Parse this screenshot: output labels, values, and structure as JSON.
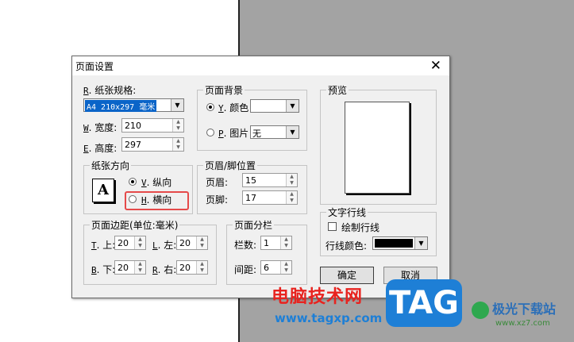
{
  "dialog": {
    "title": "页面设置",
    "close_glyph": "✕",
    "paper_size": {
      "label": "纸张规格",
      "hotkey": "R",
      "value": "A4 210x297 毫米"
    },
    "width": {
      "label": "宽度",
      "hotkey": "W",
      "value": "210"
    },
    "height": {
      "label": "高度",
      "hotkey": "E",
      "value": "297"
    },
    "orientation": {
      "title": "纸张方向",
      "icon_letter": "A",
      "portrait": {
        "hotkey": "V",
        "label": "纵向",
        "checked": true
      },
      "landscape": {
        "hotkey": "H",
        "label": "横向",
        "checked": false
      }
    },
    "background": {
      "title": "页面背景",
      "color": {
        "hotkey": "Y",
        "label": "颜色",
        "value": ""
      },
      "image": {
        "hotkey": "P",
        "label": "图片",
        "value": "无"
      }
    },
    "header_footer": {
      "title": "页眉/脚位置",
      "header": {
        "label": "页眉:",
        "value": "15"
      },
      "footer": {
        "label": "页脚:",
        "value": "17"
      }
    },
    "margins": {
      "title": "页面边距(单位:毫米)",
      "top": {
        "hotkey": "T",
        "label": "上:",
        "value": "20"
      },
      "left": {
        "hotkey": "L",
        "label": "左:",
        "value": "20"
      },
      "bottom": {
        "hotkey": "B",
        "label": "下:",
        "value": "20"
      },
      "right": {
        "hotkey": "R",
        "label": "右:",
        "value": "20"
      }
    },
    "columns": {
      "title": "页面分栏",
      "count": {
        "label": "栏数:",
        "value": "1"
      },
      "spacing": {
        "label": "间距:",
        "value": "6"
      }
    },
    "preview": {
      "title": "预览"
    },
    "text_lines": {
      "title": "文字行线",
      "draw_label": "绘制行线",
      "draw_checked": false,
      "color_label": "行线颜色:"
    },
    "ok_label": "确定",
    "cancel_label": "取消"
  },
  "watermark": {
    "site_name": "电脑技术网",
    "site_url": "www.tagxp.com",
    "tag_text": "TAG",
    "brand": "极光下载站",
    "brand_url": "www.xz7.com"
  },
  "colors": {
    "highlight": "#e54a4a",
    "tag_blue": "#1e7fd6",
    "watermark_red": "#e8231f"
  }
}
